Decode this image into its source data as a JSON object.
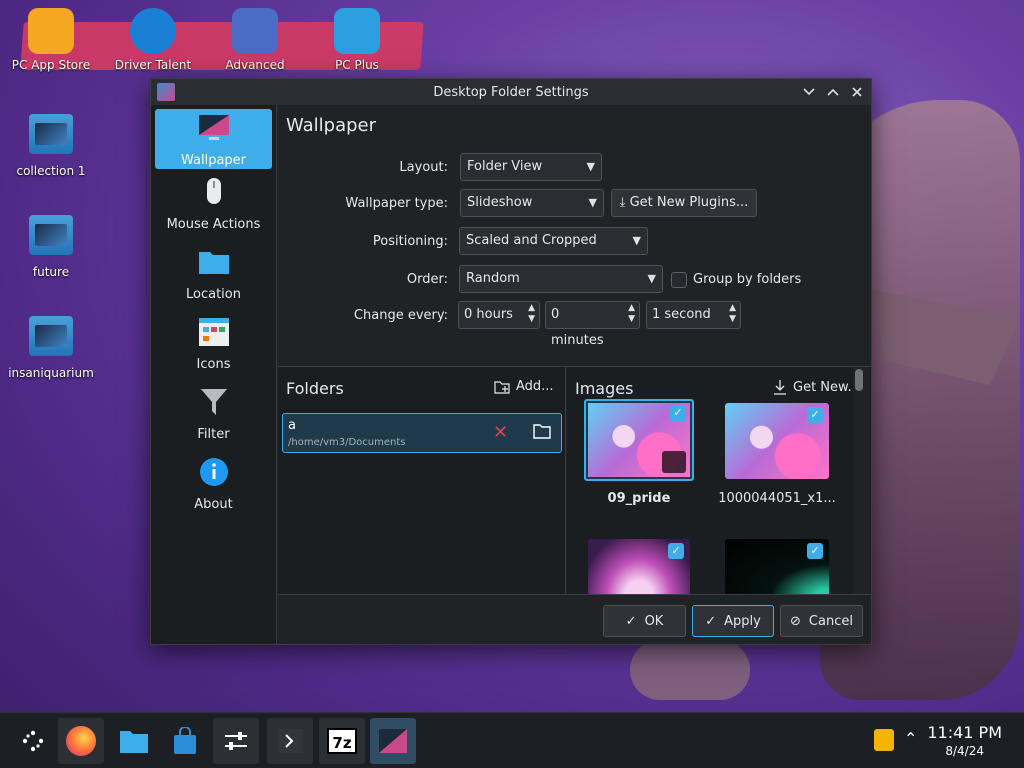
{
  "desktop": {
    "top_icons": [
      {
        "label": "PC App Store",
        "icon": "shopping-bag-icon",
        "color": "#f5a623"
      },
      {
        "label": "Driver Talent",
        "icon": "gear-icon",
        "color": "#1c7fd6"
      },
      {
        "label": "Advanced",
        "icon": "shield-gear-icon",
        "color": "#4a6cc4"
      },
      {
        "label": "PC Plus",
        "icon": "monitor-plus-icon",
        "color": "#2d9fe0"
      }
    ],
    "folders": [
      {
        "label": "collection 1"
      },
      {
        "label": "future"
      },
      {
        "label": "insaniquarium"
      }
    ]
  },
  "dialog": {
    "title": "Desktop Folder Settings",
    "sidebar": [
      {
        "label": "Wallpaper",
        "icon": "monitor-icon"
      },
      {
        "label": "Mouse Actions",
        "icon": "mouse-icon"
      },
      {
        "label": "Location",
        "icon": "folder-icon"
      },
      {
        "label": "Icons",
        "icon": "icons-grid-icon"
      },
      {
        "label": "Filter",
        "icon": "filter-icon"
      },
      {
        "label": "About",
        "icon": "info-icon"
      }
    ],
    "page_title": "Wallpaper",
    "form": {
      "layout_label": "Layout:",
      "layout_value": "Folder View",
      "type_label": "Wallpaper type:",
      "type_value": "Slideshow",
      "get_plugins": "Get New Plugins...",
      "positioning_label": "Positioning:",
      "positioning_value": "Scaled and Cropped",
      "order_label": "Order:",
      "order_value": "Random",
      "group_by_folders": "Group by folders",
      "change_every_label": "Change every:",
      "hours": "0 hours",
      "minutes": "0 minutes",
      "seconds": "1 second"
    },
    "folders_panel": {
      "title": "Folders",
      "add": "Add...",
      "items": [
        {
          "name": "a",
          "path": "/home/vm3/Documents"
        }
      ]
    },
    "images_panel": {
      "title": "Images",
      "get_new": "Get New...",
      "items": [
        {
          "label": "09_pride",
          "checked": true
        },
        {
          "label": "1000044051_x1...",
          "checked": true
        },
        {
          "label": "",
          "checked": true
        },
        {
          "label": "",
          "checked": true
        }
      ]
    },
    "buttons": {
      "ok": "OK",
      "apply": "Apply",
      "cancel": "Cancel"
    }
  },
  "taskbar": {
    "time": "11:41 PM",
    "date": "8/4/24",
    "accent": "#3daee9"
  }
}
